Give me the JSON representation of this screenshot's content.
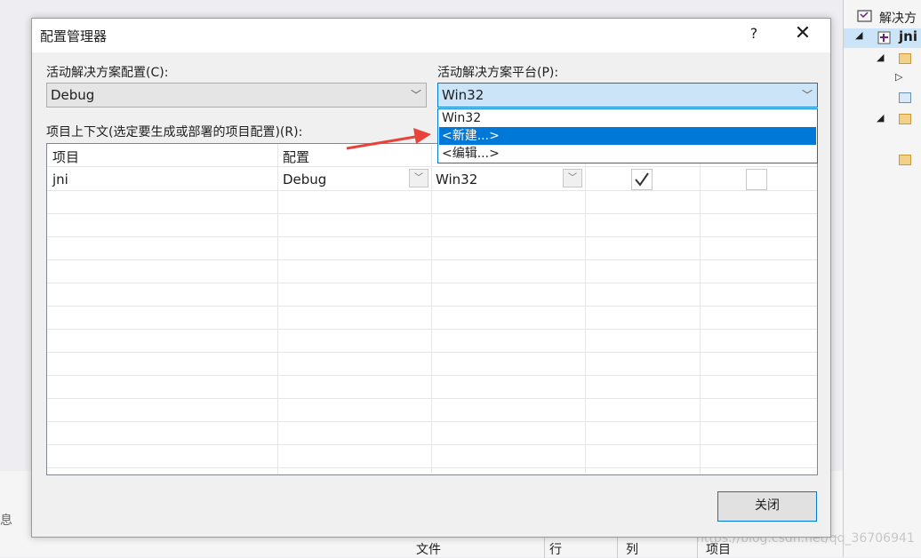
{
  "background": {
    "status_text": "息",
    "columns": [
      "文件",
      "行",
      "列",
      "项目"
    ],
    "watermark": "https://blog.csdn.net/qq_36706941"
  },
  "solution_explorer": {
    "title": "解决方",
    "project": "jni"
  },
  "dialog": {
    "title": "配置管理器",
    "help_label": "?",
    "close_label": "✕",
    "active_config_label": "活动解决方案配置(C):",
    "active_config_value": "Debug",
    "active_platform_label": "活动解决方案平台(P):",
    "active_platform_value": "Win32",
    "platform_options": [
      "Win32",
      "<新建...>",
      "<编辑...>"
    ],
    "selected_option_index": 1,
    "project_context_label": "项目上下文(选定要生成或部署的项目配置)(R):",
    "table": {
      "headers": [
        "项目",
        "配置"
      ],
      "rows": [
        {
          "project": "jni",
          "config": "Debug",
          "platform": "Win32",
          "build": true,
          "deploy": false
        }
      ]
    },
    "close_button": "关闭"
  },
  "colors": {
    "accent": "#0078d7",
    "arrow": "#e8433a"
  }
}
